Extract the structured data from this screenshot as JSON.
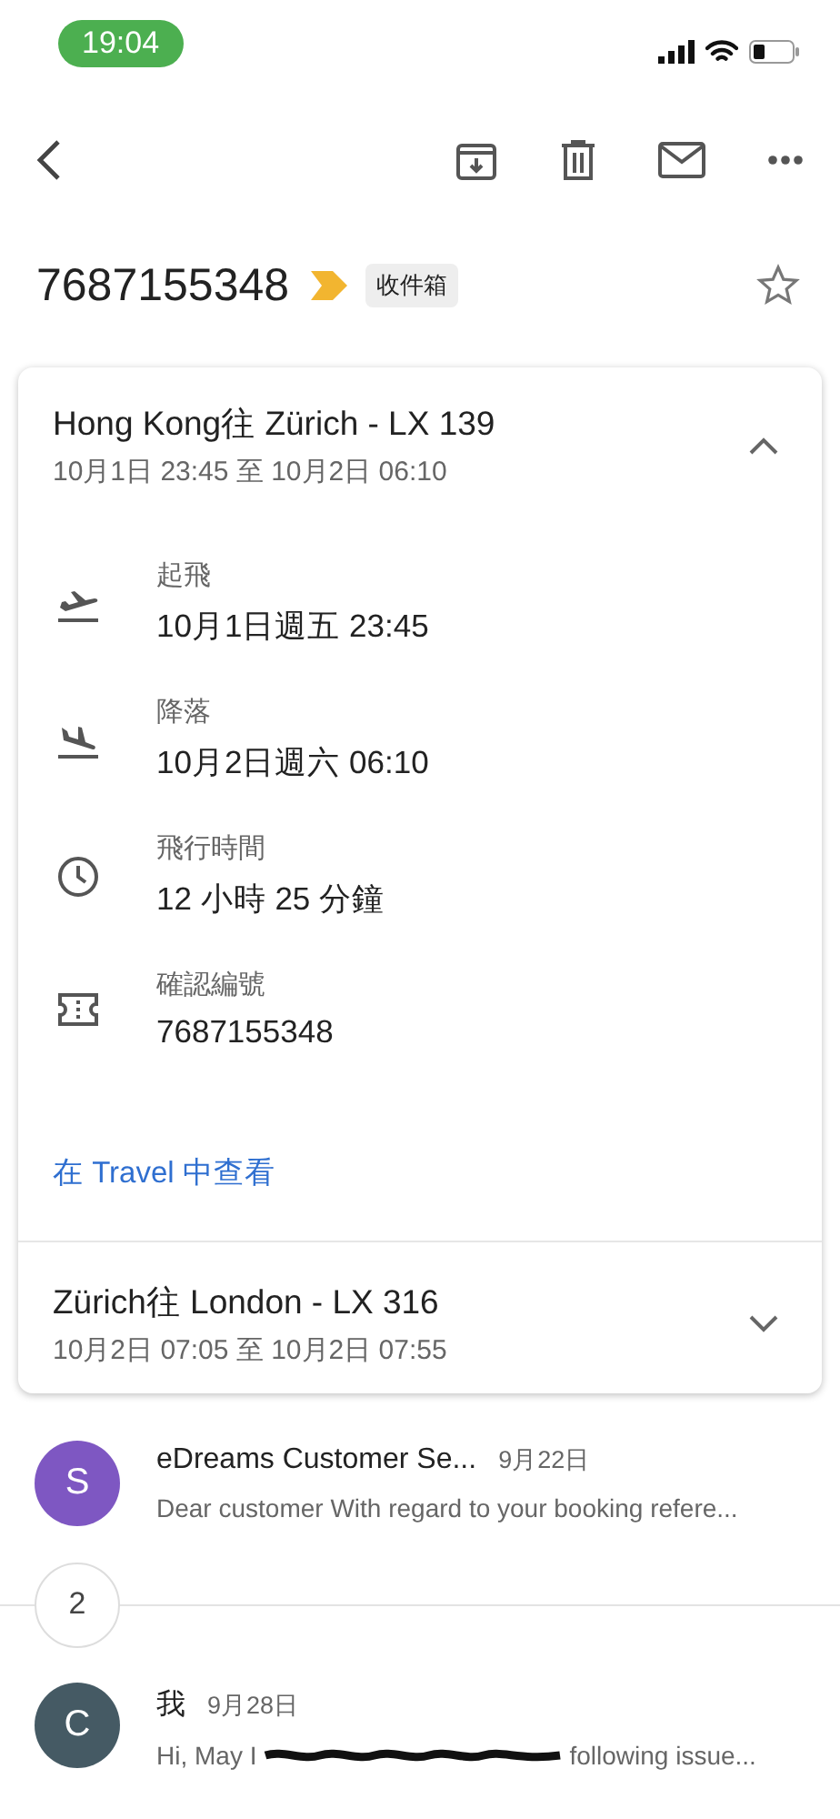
{
  "status_bar": {
    "time": "19:04"
  },
  "subject": {
    "title": "7687155348",
    "label": "收件箱",
    "important": true,
    "starred": false
  },
  "flights": [
    {
      "title": "Hong Kong往 Zürich - LX 139",
      "times": "10月1日 23:45 至 10月2日 06:10",
      "expanded": true,
      "details": [
        {
          "kind": "takeoff",
          "label": "起飛",
          "value": "10月1日週五 23:45"
        },
        {
          "kind": "landing",
          "label": "降落",
          "value": "10月2日週六 06:10"
        },
        {
          "kind": "duration",
          "label": "飛行時間",
          "value": "12 小時 25 分鐘"
        },
        {
          "kind": "ticket",
          "label": "確認編號",
          "value": "7687155348"
        }
      ],
      "link": "在 Travel 中查看"
    },
    {
      "title": "Zürich往 London - LX 316",
      "times": "10月2日 07:05 至 10月2日 07:55",
      "expanded": false
    }
  ],
  "messages": [
    {
      "avatar": "S",
      "color": "#7e57c2",
      "sender": "eDreams Customer Se...",
      "date": "9月22日",
      "snippet": [
        {
          "kind": "text",
          "text": "Dear customer With regard to your booking refere..."
        }
      ]
    },
    {
      "collapsed_count": "2"
    },
    {
      "avatar": "C",
      "color": "#455a64",
      "sender": "我",
      "date": "9月28日",
      "snippet": [
        {
          "kind": "text",
          "text": "Hi, May I"
        },
        {
          "kind": "redacted"
        },
        {
          "kind": "text",
          "text": "following issue..."
        }
      ]
    }
  ]
}
